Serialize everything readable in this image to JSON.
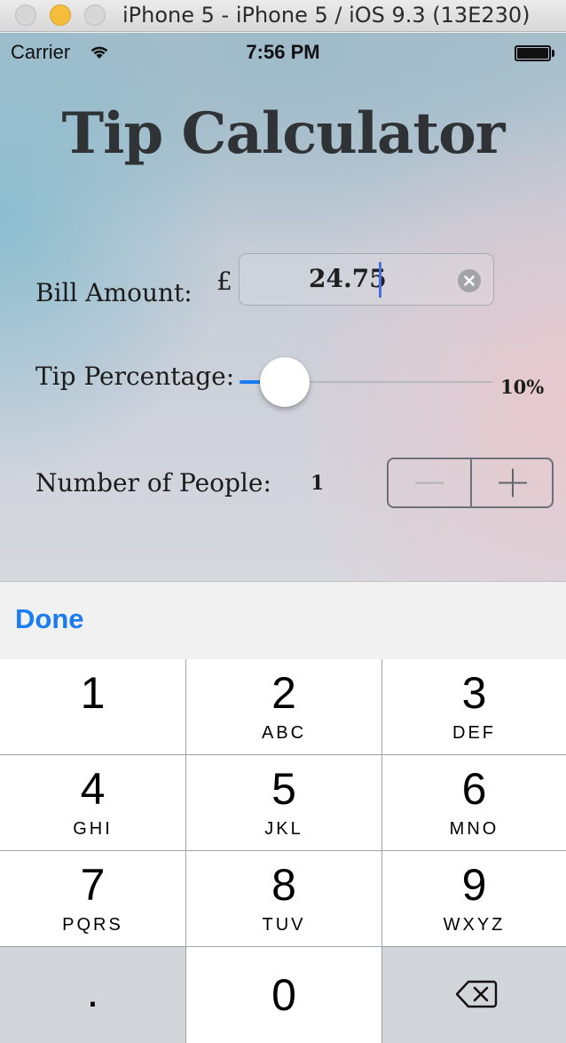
{
  "window": {
    "title": "iPhone 5 - iPhone 5 / iOS 9.3 (13E230)"
  },
  "status_bar": {
    "carrier": "Carrier",
    "time": "7:56 PM",
    "icons": [
      "wifi-icon",
      "battery-icon"
    ]
  },
  "app": {
    "title": "Tip Calculator",
    "bill": {
      "label": "Bill Amount:",
      "currency_symbol": "£",
      "value": "24.75"
    },
    "tip": {
      "label": "Tip Percentage:",
      "value_text": "10%",
      "slider_value_fraction": 0.1
    },
    "people": {
      "label": "Number of People:",
      "value": "1",
      "stepper_icons": [
        "minus-icon",
        "plus-icon"
      ]
    }
  },
  "keyboard": {
    "done_label": "Done",
    "keys": [
      {
        "digit": "1",
        "letters": ""
      },
      {
        "digit": "2",
        "letters": "ABC"
      },
      {
        "digit": "3",
        "letters": "DEF"
      },
      {
        "digit": "4",
        "letters": "GHI"
      },
      {
        "digit": "5",
        "letters": "JKL"
      },
      {
        "digit": "6",
        "letters": "MNO"
      },
      {
        "digit": "7",
        "letters": "PQRS"
      },
      {
        "digit": "8",
        "letters": "TUV"
      },
      {
        "digit": "9",
        "letters": "WXYZ"
      },
      {
        "digit": ".",
        "letters": ""
      },
      {
        "digit": "0",
        "letters": ""
      },
      {
        "digit": "",
        "letters": "",
        "icon": "backspace-icon"
      }
    ]
  },
  "colors": {
    "accent": "#1a7cf2",
    "key_background": "#ffffff",
    "key_gray": "#d2d5da"
  }
}
